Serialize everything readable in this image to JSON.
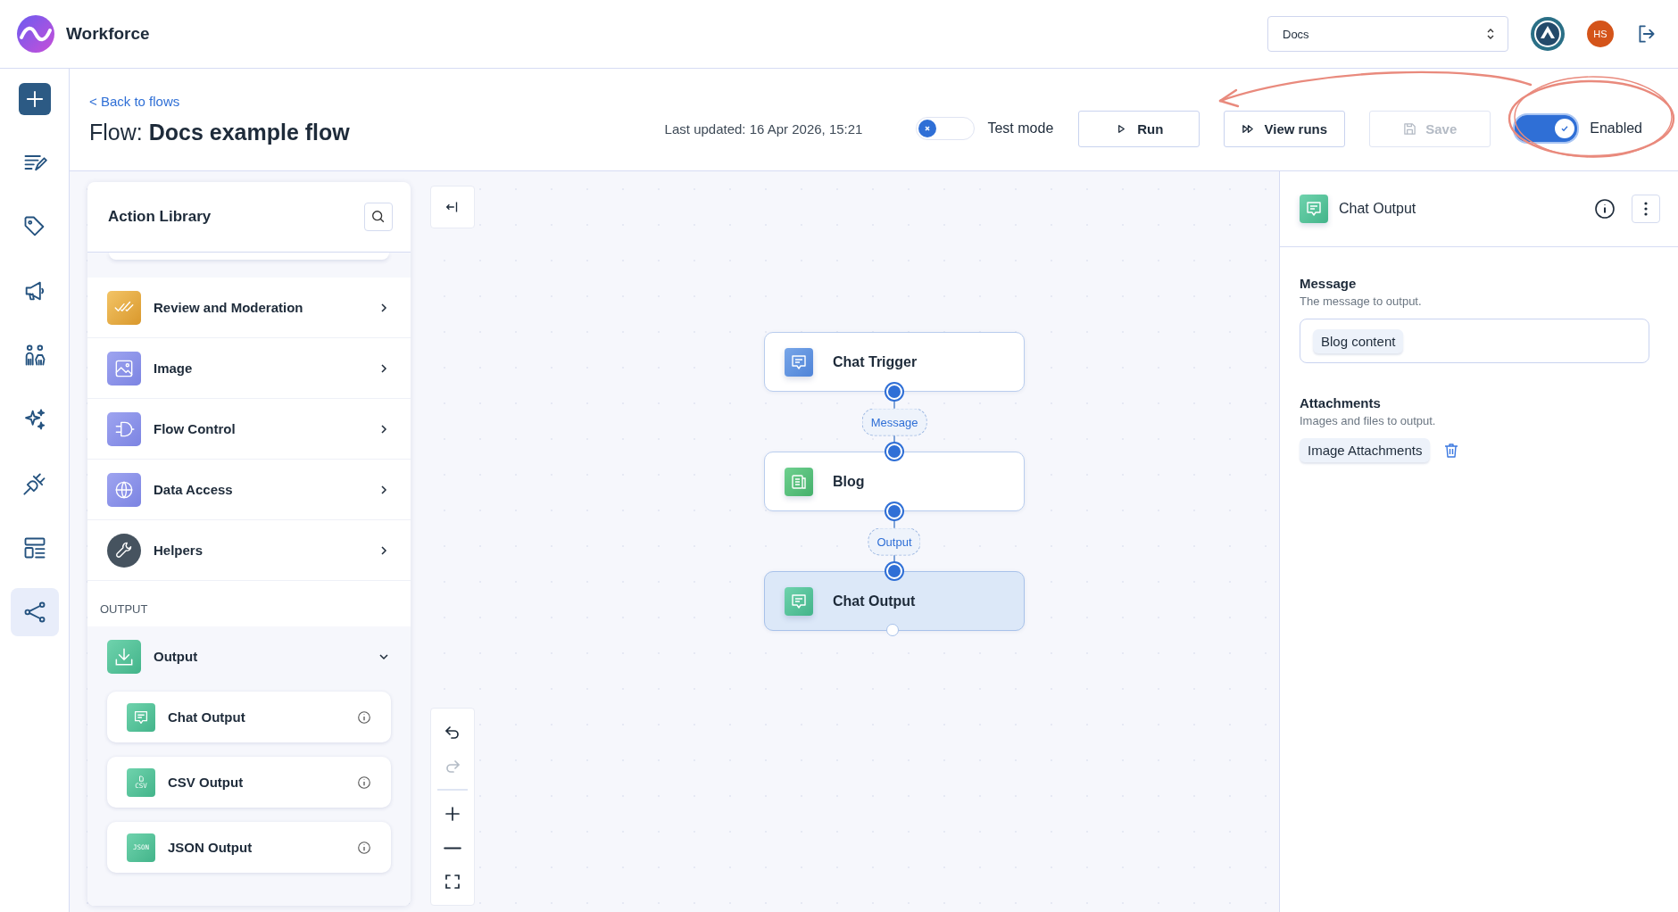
{
  "app": {
    "name": "Workforce"
  },
  "topbar": {
    "workspace_select": "Docs",
    "avatar_initials": "HS"
  },
  "rail": [
    {
      "kind": "notes",
      "selected": false
    },
    {
      "kind": "tag",
      "selected": false
    },
    {
      "kind": "megaphone",
      "selected": false
    },
    {
      "kind": "people",
      "selected": false
    },
    {
      "kind": "sparkles",
      "selected": false
    },
    {
      "kind": "plug",
      "selected": false
    },
    {
      "kind": "layout",
      "selected": false
    },
    {
      "kind": "flow",
      "selected": true
    }
  ],
  "header": {
    "back_link": "< Back to flows",
    "title": "Flow: **Docs example flow**",
    "last_updated": "Last updated: 16 Apr 2026, 15:21",
    "test_mode": {
      "label": "Test mode",
      "on": false
    },
    "buttons": [
      {
        "label": "Run",
        "kind": "run",
        "disabled": false
      },
      {
        "label": "View runs",
        "kind": "view-runs",
        "disabled": false
      },
      {
        "label": "Save",
        "kind": "save",
        "disabled": true
      }
    ],
    "enabled": {
      "label": "Enabled",
      "on": true
    }
  },
  "library": {
    "title": "Action Library",
    "categories": [
      {
        "label": "Review and Moderation",
        "kind": "review"
      },
      {
        "label": "Image",
        "kind": "image"
      },
      {
        "label": "Flow Control",
        "kind": "flow-control"
      },
      {
        "label": "Data Access",
        "kind": "data"
      },
      {
        "label": "Helpers",
        "kind": "helpers"
      }
    ],
    "section_label": "OUTPUT",
    "group": {
      "label": "Output",
      "expanded": true,
      "actions": [
        {
          "label": "Chat Output",
          "kind": "chat"
        },
        {
          "label": "CSV Output",
          "kind": "file",
          "badge": "CSV"
        },
        {
          "label": "JSON Output",
          "kind": "text",
          "badge": "JSON"
        }
      ]
    }
  },
  "tools": [
    {
      "kind": "undo",
      "disabled": false
    },
    {
      "kind": "redo",
      "disabled": true
    },
    {
      "kind": "zoom-in",
      "disabled": false
    },
    {
      "kind": "zoom-out",
      "disabled": false
    },
    {
      "kind": "fit",
      "disabled": false
    }
  ],
  "canvas": {
    "nodes": [
      {
        "label": "Chat Trigger",
        "kind": "chat-trigger",
        "selected": false
      },
      {
        "label": "Blog",
        "kind": "blog",
        "selected": false
      },
      {
        "label": "Chat Output",
        "kind": "chat-output",
        "selected": true
      }
    ],
    "edges": [
      {
        "label": "Message"
      },
      {
        "label": "Output"
      }
    ]
  },
  "inspector": {
    "title": "Chat Output",
    "fields": [
      {
        "label": "Message",
        "help": "The message to output.",
        "kind": "input",
        "chips": [
          "Blog content"
        ]
      },
      {
        "label": "Attachments",
        "help": "Images and files to output.",
        "kind": "list",
        "chips": [
          "Image Attachments"
        ]
      }
    ]
  }
}
